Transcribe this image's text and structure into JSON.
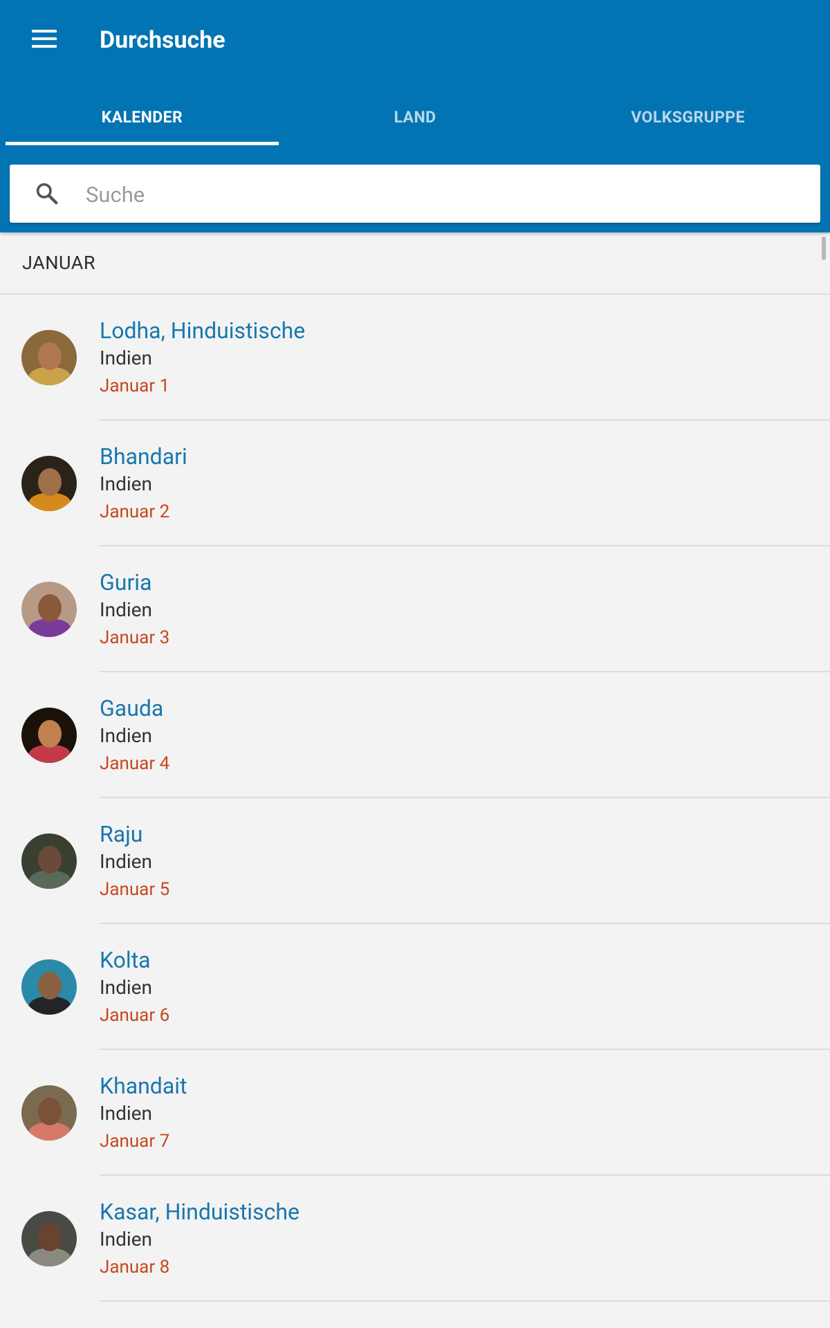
{
  "app_bar": {
    "title": "Durchsuche",
    "color": "#0274b4"
  },
  "tabs": [
    {
      "label": "KALENDER",
      "active": true
    },
    {
      "label": "LAND",
      "active": false
    },
    {
      "label": "VOLKSGRUPPE",
      "active": false
    }
  ],
  "search": {
    "placeholder": "Suche",
    "value": ""
  },
  "section": {
    "header": "JANUAR"
  },
  "items": [
    {
      "name": "Lodha, Hinduistische",
      "country": "Indien",
      "date": "Januar 1",
      "avatar": {
        "bg": "#8a6a3a",
        "skin": "#b07850",
        "body": "#c9a24a"
      }
    },
    {
      "name": "Bhandari",
      "country": "Indien",
      "date": "Januar 2",
      "avatar": {
        "bg": "#2a2418",
        "skin": "#a0704a",
        "body": "#d68a1c"
      }
    },
    {
      "name": "Guria",
      "country": "Indien",
      "date": "Januar 3",
      "avatar": {
        "bg": "#b69a86",
        "skin": "#8a5a3a",
        "body": "#7a3a9a"
      }
    },
    {
      "name": "Gauda",
      "country": "Indien",
      "date": "Januar 4",
      "avatar": {
        "bg": "#1a1208",
        "skin": "#c08050",
        "body": "#c23a4a"
      }
    },
    {
      "name": "Raju",
      "country": "Indien",
      "date": "Januar 5",
      "avatar": {
        "bg": "#3a4030",
        "skin": "#6a4a3a",
        "body": "#5a6a5a"
      }
    },
    {
      "name": "Kolta",
      "country": "Indien",
      "date": "Januar 6",
      "avatar": {
        "bg": "#2a8aa8",
        "skin": "#8a6040",
        "body": "#222428"
      }
    },
    {
      "name": "Khandait",
      "country": "Indien",
      "date": "Januar 7",
      "avatar": {
        "bg": "#7a6a50",
        "skin": "#7a5238",
        "body": "#d8786a"
      }
    },
    {
      "name": "Kasar, Hinduistische",
      "country": "Indien",
      "date": "Januar 8",
      "avatar": {
        "bg": "#4a4a44",
        "skin": "#6a4230",
        "body": "#8a8a80"
      }
    }
  ]
}
